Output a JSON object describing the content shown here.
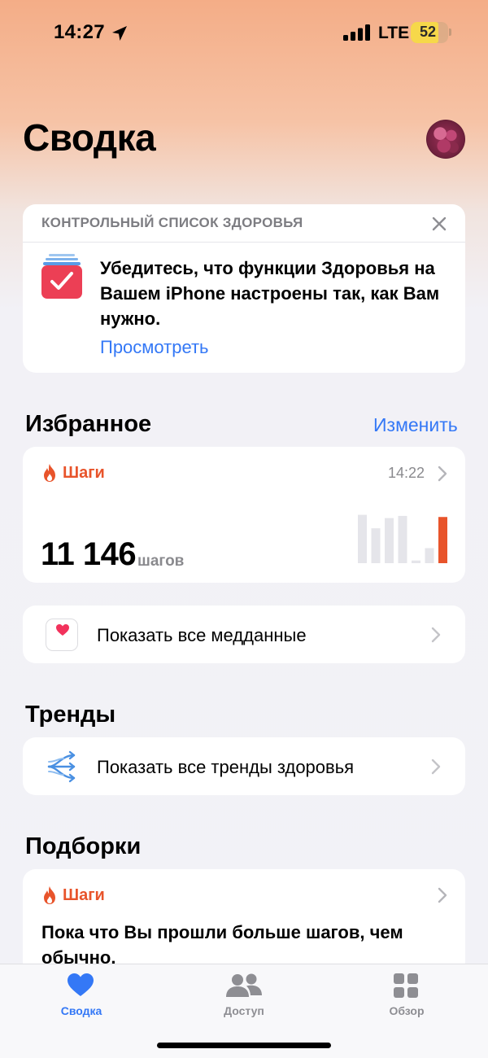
{
  "status_bar": {
    "time": "14:27",
    "network": "LTE",
    "battery": "52",
    "battery_level": 0.52
  },
  "header": {
    "title": "Сводка"
  },
  "checklist": {
    "title": "КОНТРОЛЬНЫЙ СПИСОК ЗДОРОВЬЯ",
    "text": "Убедитесь, что функции Здоровья на Вашем iPhone настроены так, как Вам нужно.",
    "link": "Просмотреть"
  },
  "favorites": {
    "title": "Избранное",
    "edit_label": "Изменить",
    "steps_card": {
      "label": "Шаги",
      "time": "14:22",
      "value": "11 146",
      "unit": "шагов",
      "bars": [
        0.9,
        0.65,
        0.84,
        0.88,
        0.05,
        0.28,
        0.86
      ]
    },
    "all_health_data_label": "Показать все медданные"
  },
  "trends": {
    "title": "Тренды",
    "link_label": "Показать все тренды здоровья"
  },
  "highlights": {
    "title": "Подборки",
    "card": {
      "label": "Шаги",
      "text": "Пока что Вы прошли больше шагов, чем обычно."
    }
  },
  "tabbar": {
    "tabs": [
      {
        "label": "Сводка",
        "active": true
      },
      {
        "label": "Доступ",
        "active": false
      },
      {
        "label": "Обзор",
        "active": false
      }
    ]
  },
  "colors": {
    "accent": "#3478f6",
    "steps": "#e8542b",
    "inactive_tab": "#8e8e93"
  }
}
